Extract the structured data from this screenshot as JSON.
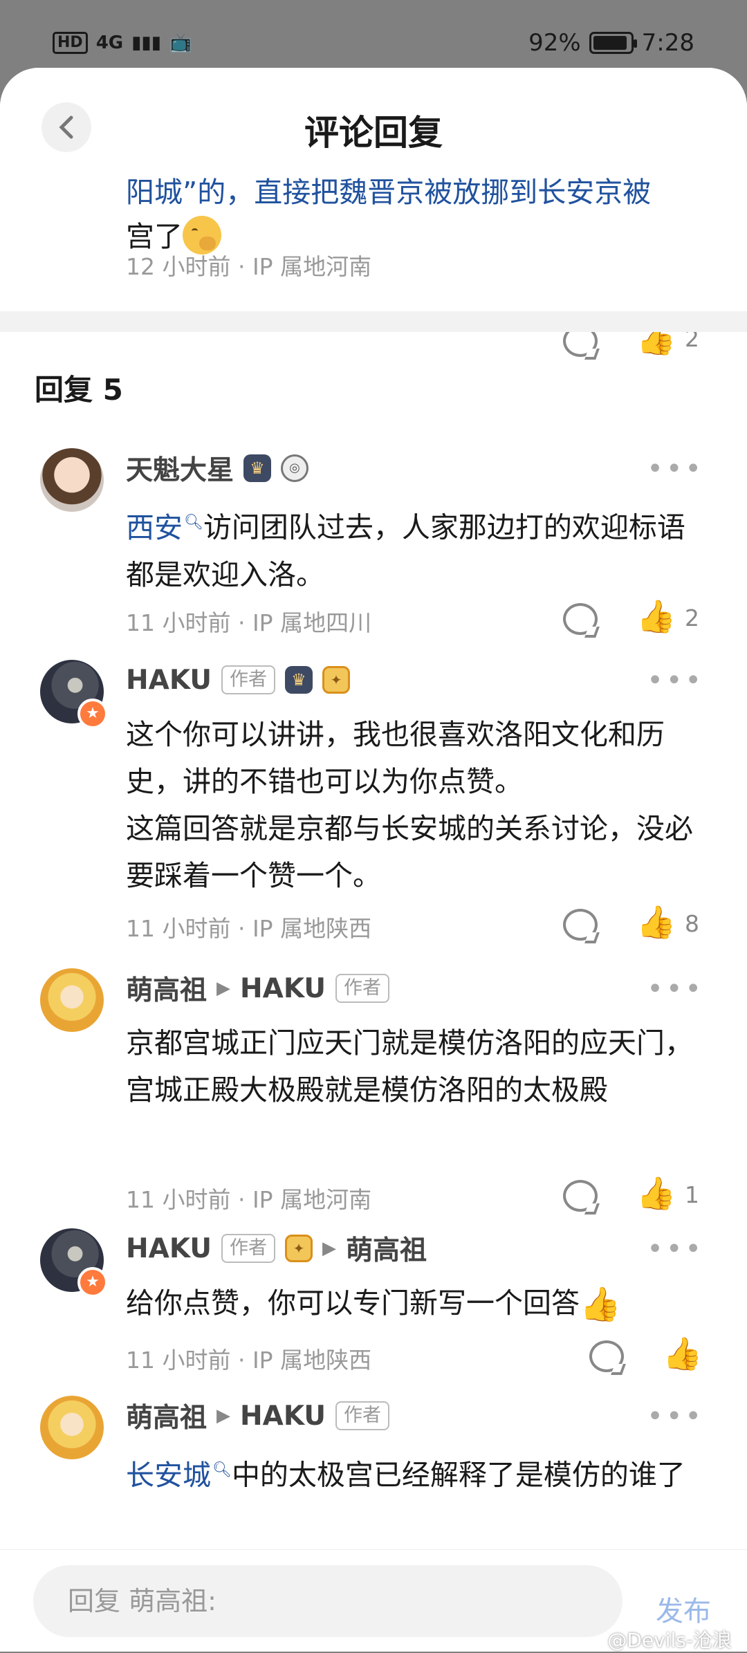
{
  "status": {
    "network": "HD",
    "signal": "4G",
    "battery": "92%",
    "battery_level": 0.92,
    "time": "7:28"
  },
  "header": {
    "title": "评论回复"
  },
  "prev_comment": {
    "text_partial": "阳城”的，直接把魏晋京被放挪到长安京被",
    "text_line2": "宫了",
    "meta": "12 小时前 · IP 属地河南",
    "likes": "2"
  },
  "section": {
    "title": "回复 5"
  },
  "comments": [
    {
      "name": "天魁大星",
      "link": "西安",
      "text": "访问团队过去，人家那边打的欢迎标语都是欢迎入洛。",
      "meta": "11 小时前 · IP 属地四川",
      "likes": "2"
    },
    {
      "name": "HAKU",
      "author_tag": "作者",
      "text1": "这个你可以讲讲，我也很喜欢洛阳文化和历史，讲的不错也可以为你点赞。",
      "text2": "这篇回答就是京都与长安城的关系讨论，没必要踩着一个赞一个。",
      "meta": "11 小时前 · IP 属地陕西",
      "likes": "8"
    },
    {
      "name": "萌高祖",
      "reply_to": "HAKU",
      "author_tag": "作者",
      "text": "京都宫城正门应天门就是模仿洛阳的应天门，宫城正殿大极殿就是模仿洛阳的太极殿",
      "meta": "11 小时前 · IP 属地河南",
      "likes": "1"
    },
    {
      "name": "HAKU",
      "author_tag": "作者",
      "reply_to": "萌高祖",
      "text": "给你点赞，你可以专门新写一个回答",
      "meta": "11 小时前 · IP 属地陕西"
    },
    {
      "name": "萌高祖",
      "reply_to": "HAKU",
      "author_tag": "作者",
      "link": "长安城",
      "text": "中的太极宫已经解释了是模仿的谁了"
    }
  ],
  "bottom": {
    "placeholder": "回复 萌高祖:",
    "publish": "发布"
  },
  "watermark": "@Devils-沧浪"
}
